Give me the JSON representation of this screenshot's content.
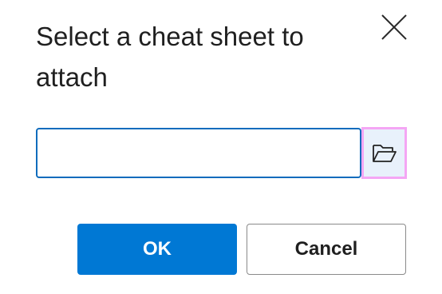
{
  "dialog": {
    "title": "Select a cheat sheet to attach",
    "close_icon": "close-icon",
    "path_field": {
      "value": "",
      "placeholder": ""
    },
    "browse_icon": "folder-open-icon",
    "ok_label": "OK",
    "cancel_label": "Cancel"
  },
  "colors": {
    "accent": "#0078d4",
    "input_border": "#0f6cbd",
    "focus_ring": "#f4a6f4",
    "browse_bg": "#e8f1fb"
  }
}
